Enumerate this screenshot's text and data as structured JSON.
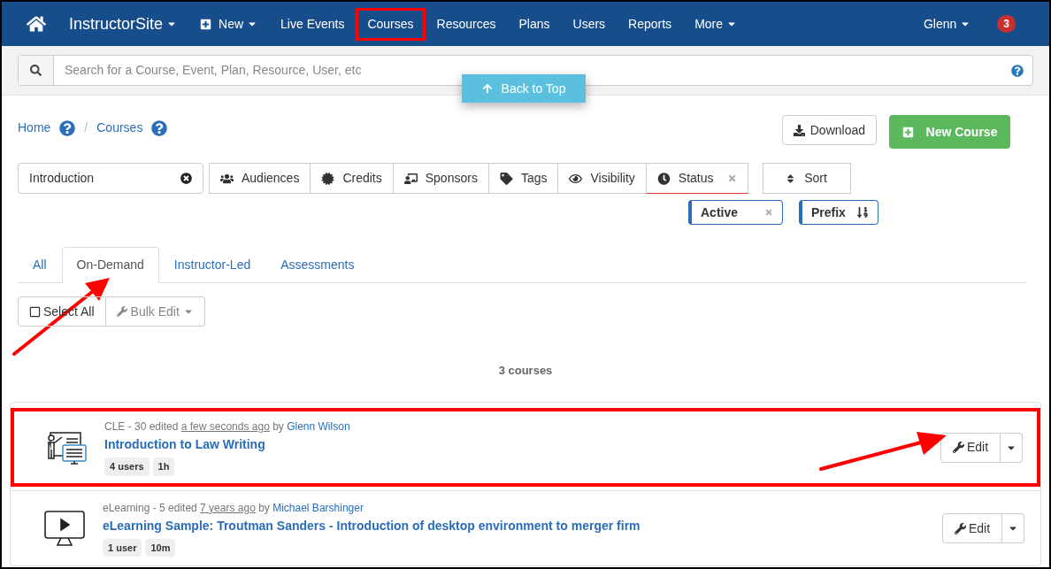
{
  "nav": {
    "brand": "InstructorSite",
    "items": [
      {
        "label": "New",
        "kind": "new",
        "caret": true,
        "highlighted": false
      },
      {
        "label": "Live Events",
        "kind": "link",
        "caret": false,
        "highlighted": false
      },
      {
        "label": "Courses",
        "kind": "link",
        "caret": false,
        "highlighted": true
      },
      {
        "label": "Resources",
        "kind": "link",
        "caret": false,
        "highlighted": false
      },
      {
        "label": "Plans",
        "kind": "link",
        "caret": false,
        "highlighted": false
      },
      {
        "label": "Users",
        "kind": "link",
        "caret": false,
        "highlighted": false
      },
      {
        "label": "Reports",
        "kind": "link",
        "caret": false,
        "highlighted": false
      },
      {
        "label": "More",
        "kind": "link",
        "caret": true,
        "highlighted": false
      }
    ],
    "user": "Glenn",
    "badge": "3"
  },
  "search": {
    "placeholder": "Search for a Course, Event, Plan, Resource, User, etc"
  },
  "back_to_top": "Back to Top",
  "breadcrumb": [
    {
      "label": "Home"
    },
    {
      "label": "Courses"
    }
  ],
  "breadcrumb_separator": "/",
  "download": "Download",
  "new_course": "New Course",
  "filter_text": "Introduction",
  "filters": [
    {
      "label": "Audiences",
      "kind": "audiences",
      "active": false
    },
    {
      "label": "Credits",
      "kind": "credits",
      "active": false
    },
    {
      "label": "Sponsors",
      "kind": "sponsors",
      "active": false
    },
    {
      "label": "Tags",
      "kind": "tags",
      "active": false
    },
    {
      "label": "Visibility",
      "kind": "visibility",
      "active": false
    },
    {
      "label": "Status",
      "kind": "status",
      "active": true
    }
  ],
  "sort": "Sort",
  "chips": [
    {
      "label": "Active",
      "kind": "removable"
    },
    {
      "label": "Prefix",
      "kind": "sort"
    }
  ],
  "tabs": [
    {
      "label": "All",
      "selected": false
    },
    {
      "label": "On-Demand",
      "selected": true
    },
    {
      "label": "Instructor-Led",
      "selected": false
    },
    {
      "label": "Assessments",
      "selected": false
    }
  ],
  "select_all": {
    "label": "Select All",
    "checked": false
  },
  "bulk_edit": {
    "label": "Bulk Edit",
    "disabled": true
  },
  "count": "3 courses",
  "courses": [
    {
      "kind": "classroom",
      "category": "CLE - 30 edited",
      "time": "a few seconds ago",
      "by": "by",
      "author": "Glenn Wilson",
      "title": "Introduction to Law Writing",
      "tags": [
        "4 users",
        "1h"
      ],
      "edit": "Edit",
      "highlighted": true
    },
    {
      "kind": "video",
      "category": "eLearning - 5 edited",
      "time": "7 years ago",
      "by": "by",
      "author": "Michael Barshinger",
      "title": "eLearning Sample: Troutman Sanders - Introduction of desktop environment to merger firm",
      "tags": [
        "1 user",
        "10m"
      ],
      "edit": "Edit",
      "highlighted": false
    }
  ]
}
